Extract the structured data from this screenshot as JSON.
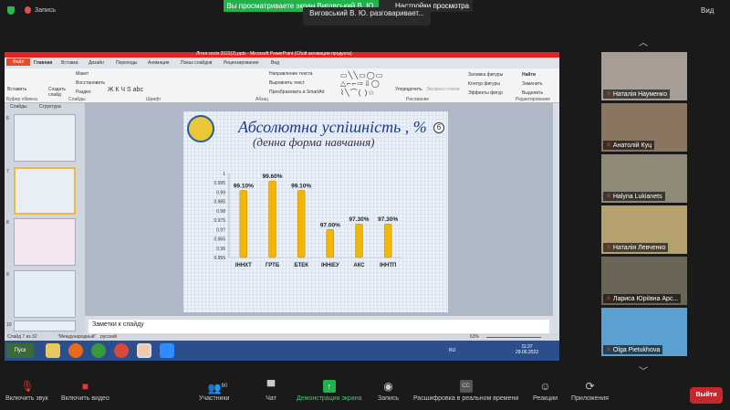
{
  "topbar": {
    "record": "Запись",
    "banner": "Вы просматриваете экран Виговський В. Ю.",
    "view_options": "Настройки просмотра",
    "speaking": "Виговський В. Ю. разговаривает...",
    "view": "Вид"
  },
  "ppt": {
    "title": "Літня сесія 2022(2).pptx - Microsoft PowerPoint (Сбой активации продукта)",
    "tabs": [
      "Файл",
      "Главная",
      "Вставка",
      "Дизайн",
      "Переходы",
      "Анимация",
      "Показ слайдов",
      "Рецензирование",
      "Вид"
    ],
    "ribbon": {
      "paste": "Вставить",
      "clipboard": "Буфер обмена",
      "new_slide": "Создать слайд",
      "layout": "Макет",
      "reset": "Восстановить",
      "section": "Раздел",
      "slides": "Слайды",
      "font": "Шрифт",
      "paragraph": "Абзац",
      "text_dir": "Направление текста",
      "align_text": "Выровнять текст",
      "smartart": "Преобразовать в SmartArt",
      "drawing": "Рисование",
      "arrange": "Упорядочить",
      "quick_styles": "Экспресс-стили",
      "fill": "Заливка фигуры",
      "outline": "Контур фигуры",
      "effects": "Эффекты фигур",
      "find": "Найти",
      "replace": "Заменить",
      "select": "Выделить",
      "editing": "Редактирование"
    },
    "pane_tabs": [
      "Слайды",
      "Структура"
    ],
    "thumb_numbers": [
      "6",
      "7",
      "8",
      "9",
      "10"
    ],
    "notes_placeholder": "Заметки к слайду",
    "status": {
      "slide": "Слайд 7 из 32",
      "theme": "\"Международный\"",
      "lang": "русский",
      "zoom": "63%"
    },
    "taskbar": {
      "start": "Пуск",
      "lang": "RU",
      "time": "11:37",
      "date": "29.06.2022"
    }
  },
  "slide": {
    "title": "Абсолютна успішність , %",
    "subtitle": "(денна форма навчання)",
    "number": "6"
  },
  "chart_data": {
    "type": "bar",
    "categories": [
      "ІННХТ",
      "ГРТБ",
      "БТЕК",
      "ІННІЕУ",
      "АКС",
      "ІННТП"
    ],
    "values": [
      0.991,
      0.996,
      0.991,
      0.97,
      0.973,
      0.973
    ],
    "labels": [
      "99.10%",
      "99.60%",
      "99.10%",
      "97.00%",
      "97.30%",
      "97.30%"
    ],
    "ylim": [
      0.955,
      1
    ],
    "yticks": [
      "1",
      "0.995",
      "0.99",
      "0.985",
      "0.98",
      "0.975",
      "0.97",
      "0.965",
      "0.96",
      "0.955"
    ],
    "bar_color": "#f2b705"
  },
  "participants": [
    {
      "name": "Наталія Науменко"
    },
    {
      "name": "Анатолій Куц"
    },
    {
      "name": "Halyna Lukianets"
    },
    {
      "name": "Наталія Левченко"
    },
    {
      "name": "Лариса Юріївна Арс..."
    },
    {
      "name": "Olga Pietukhova"
    }
  ],
  "toolbar": {
    "unmute": "Включить звук",
    "video": "Включить видео",
    "participants": "Участники",
    "count": "60",
    "chat": "Чат",
    "share": "Демонстрация экрана",
    "record": "Запись",
    "captions": "Расшифровка в реальном времени",
    "reactions": "Реакции",
    "apps": "Приложения",
    "leave": "Выйти"
  },
  "colors": {
    "accent_green": "#23b14d",
    "leave": "#c5282a",
    "ppt_red": "#e32222"
  }
}
